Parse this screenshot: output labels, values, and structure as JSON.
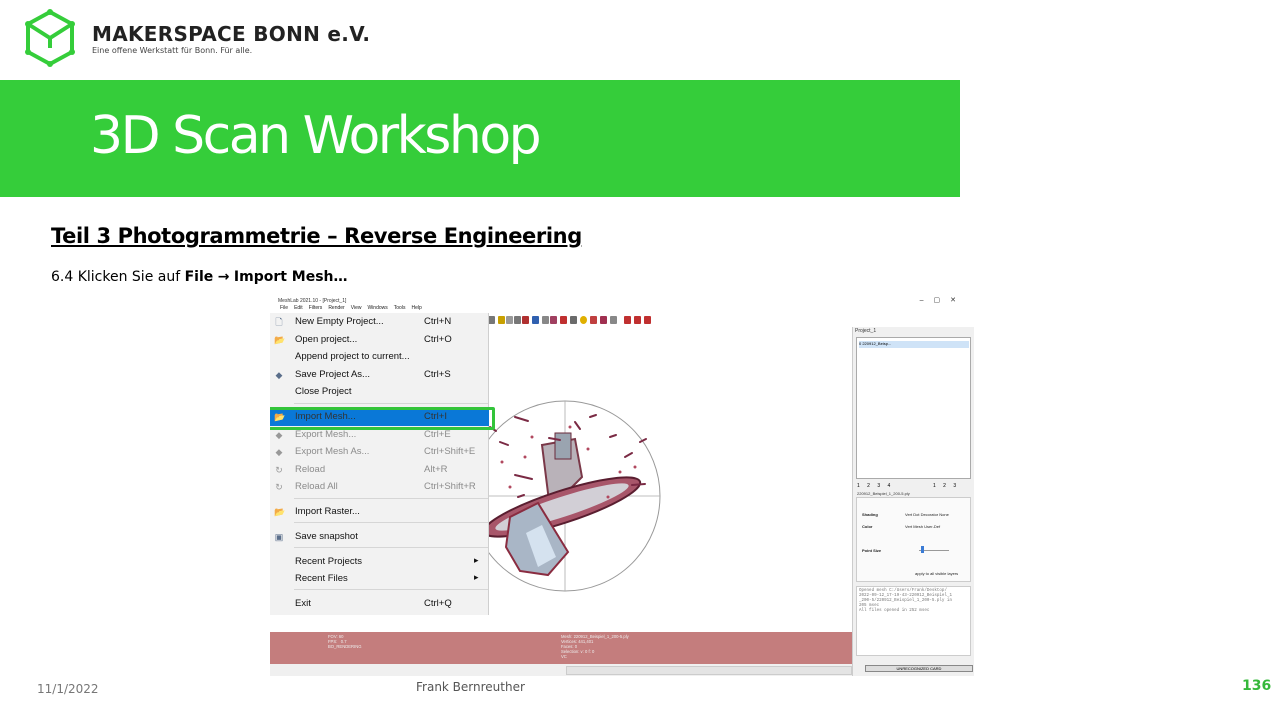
{
  "header": {
    "brand_name": "MAKERSPACE BONN e.V.",
    "brand_tagline": "Eine offene Werkstatt für Bonn. Für alle.",
    "logo_icon": "makerspace-cube-logo",
    "accent_color": "#35cd3a"
  },
  "banner": {
    "title": "3D Scan Workshop"
  },
  "content": {
    "section_heading": "Teil 3  Photogrammetrie  – Reverse Engineering",
    "step_prefix": "6.4 Klicken Sie auf ",
    "step_file": "File",
    "step_arrow": "→",
    "step_target": "Import Mesh…"
  },
  "meshlab": {
    "window_title": "MeshLab 2021.10 - [Project_1]",
    "window_buttons": [
      "–",
      "▢",
      "✕"
    ],
    "menubar": [
      "File",
      "Edit",
      "Filters",
      "Render",
      "View",
      "Windows",
      "Tools",
      "Help"
    ],
    "file_menu": [
      {
        "label": "New Empty Project...",
        "shortcut": "Ctrl+N",
        "icon": "new-document-icon",
        "disabled": false
      },
      {
        "label": "Open project...",
        "shortcut": "Ctrl+O",
        "icon": "open-folder-icon",
        "disabled": false
      },
      {
        "label": "Append project to current...",
        "shortcut": "",
        "icon": "",
        "disabled": false
      },
      {
        "label": "Save Project As...",
        "shortcut": "Ctrl+S",
        "icon": "save-project-icon",
        "disabled": false
      },
      {
        "label": "Close Project",
        "shortcut": "",
        "icon": "",
        "disabled": false
      },
      {
        "label": "Import Mesh...",
        "shortcut": "Ctrl+I",
        "icon": "import-folder-icon",
        "disabled": false,
        "highlighted": true
      },
      {
        "label": "Export Mesh...",
        "shortcut": "Ctrl+E",
        "icon": "export-mesh-icon",
        "disabled": true
      },
      {
        "label": "Export Mesh As...",
        "shortcut": "Ctrl+Shift+E",
        "icon": "export-mesh-as-icon",
        "disabled": true
      },
      {
        "label": "Reload",
        "shortcut": "Alt+R",
        "icon": "reload-icon",
        "disabled": true
      },
      {
        "label": "Reload All",
        "shortcut": "Ctrl+Shift+R",
        "icon": "reload-all-icon",
        "disabled": true
      },
      {
        "label": "Import Raster...",
        "shortcut": "",
        "icon": "import-raster-icon",
        "disabled": false
      },
      {
        "label": "Save snapshot",
        "shortcut": "",
        "icon": "camera-icon",
        "disabled": false
      },
      {
        "label": "Recent Projects",
        "shortcut": "",
        "icon": "",
        "disabled": false,
        "submenu": true
      },
      {
        "label": "Recent Files",
        "shortcut": "",
        "icon": "",
        "disabled": false,
        "submenu": true
      },
      {
        "label": "Exit",
        "shortcut": "Ctrl+Q",
        "icon": "",
        "disabled": false
      }
    ],
    "right_panel": {
      "title": "Project_1",
      "layer_row": "0   220912_Beisp...",
      "tabs_left": "1 2 3 4",
      "tabs_right": "1 2 3",
      "file_label": "220912_Beispiel_1_200-5.ply",
      "shading_label": "Shading",
      "shading_options": "Vert  Dot Decorator  None",
      "color_label": "Color",
      "color_options": "Vert  Mesh  User-Def",
      "point_size_label": "Point Size",
      "apply_label": "apply to all visible layers",
      "log_text": "Opened mesh C:/Users/Frank/Desktop/\n2022-09-12_17-19-43-220912_Beispiel_1\n_200-5/220912_Beispiel_1_200-5.ply in\n205 msec\nAll files opened in 252 msec",
      "bottom_button": "UNRECOGNIZED CARD"
    },
    "info_left": "FOV: 60\nFPS:   0.7\nBO_RENDERING",
    "info_right": "Mesh: 220912_Beispiel_1_200-5.ply\nVertices: 441,401\nFaces: 0\nSelection: v: 0 f: 0\nVC"
  },
  "footer": {
    "date": "11/1/2022",
    "author": "Frank Bernreuther",
    "page_number": "136"
  }
}
